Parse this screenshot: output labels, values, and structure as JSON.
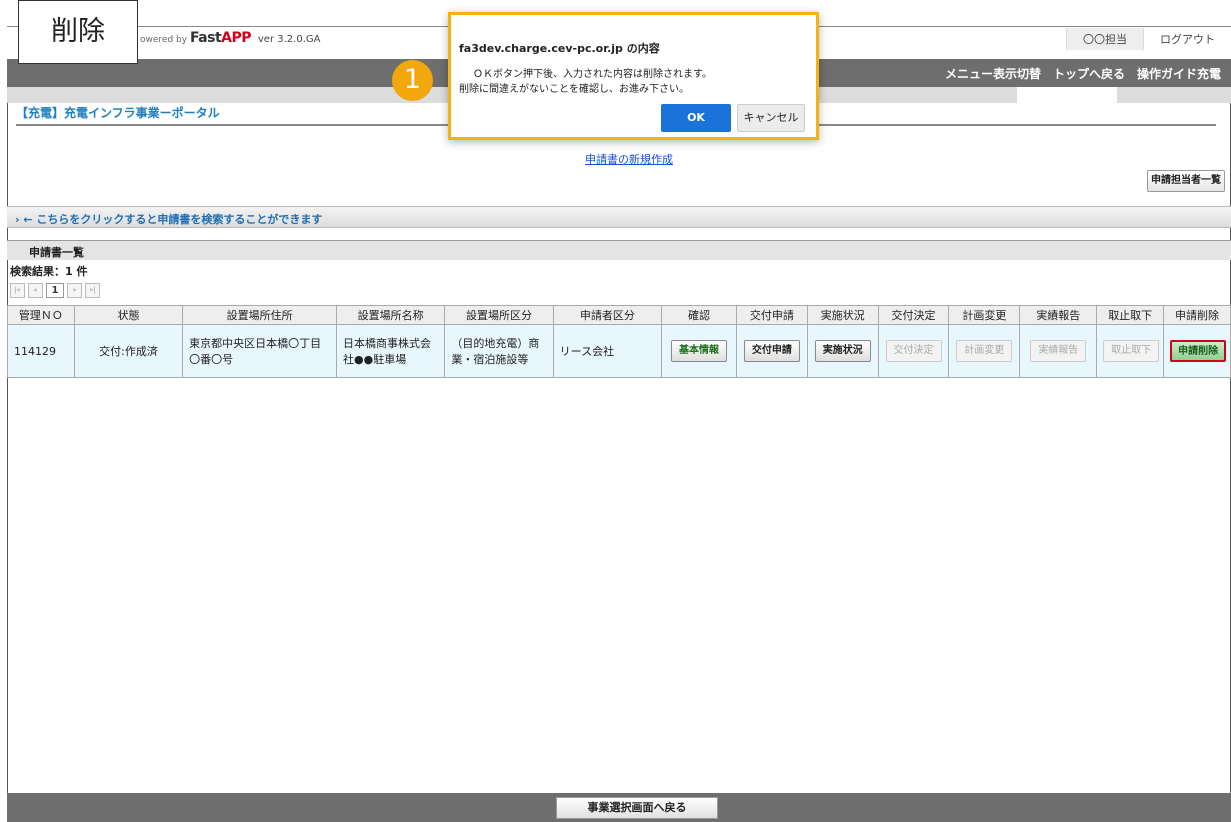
{
  "annotation": {
    "label": "削除",
    "step_number": "1"
  },
  "header": {
    "powered_by": "owered by",
    "brand_fast": "Fast",
    "brand_app": "APP",
    "version": "ver 3.2.0.GA",
    "account": "〇〇担当",
    "logout": "ログアウト"
  },
  "nav": {
    "menu_toggle": "メニュー表示切替",
    "back_top": "トップへ戻る",
    "guide": "操作ガイド充電"
  },
  "portal_title": "【充電】充電インフラ事業ーポータル",
  "new_application_link": "申請書の新規作成",
  "persons_button": "申請担当者一覧",
  "search_toggle": "›  ←  こちらをクリックすると申請書を検索することができます",
  "list": {
    "section_title": "申請書一覧",
    "result_count": "検索結果：1 件",
    "pager": {
      "first": "|«",
      "prev": "«",
      "current": "1",
      "next": "»",
      "last": "»|"
    },
    "columns": [
      "管理ＮＯ",
      "状態",
      "設置場所住所",
      "設置場所名称",
      "設置場所区分",
      "申請者区分",
      "確認",
      "交付申請",
      "実施状況",
      "交付決定",
      "計画変更",
      "実績報告",
      "取止取下",
      "申請削除"
    ],
    "rows": [
      {
        "id": "114129",
        "status": "交付:作成済",
        "address": "東京都中央区日本橋〇丁目〇番〇号",
        "name": "日本橋商事株式会社●●駐車場",
        "category": "（目的地充電）商業・宿泊施設等",
        "applicant": "リース会社",
        "btn_confirm": "基本情報",
        "btn_grant": "交付申請",
        "btn_status": "実施状況",
        "btn_decision": "交付決定",
        "btn_change": "計画変更",
        "btn_report": "実績報告",
        "btn_withdraw": "取止取下",
        "btn_delete": "申請削除"
      }
    ]
  },
  "footer_back": "事業選択画面へ戻る",
  "dialog": {
    "host": "fa3dev.charge.cev-pc.or.jp の内容",
    "message1": "ＯＫボタン押下後、入力された内容は削除されます。",
    "message2": "削除に間違えがないことを確認し、お進み下さい。",
    "ok": "OK",
    "cancel": "キャンセル"
  },
  "colors": {
    "accent_dialog": "#f3b413",
    "badge": "#f2a70d",
    "ok_button": "#1a73d9",
    "navbar": "#6e6e6e",
    "row_bg": "#e8f7fd",
    "delete_highlight": "#d0021b"
  }
}
